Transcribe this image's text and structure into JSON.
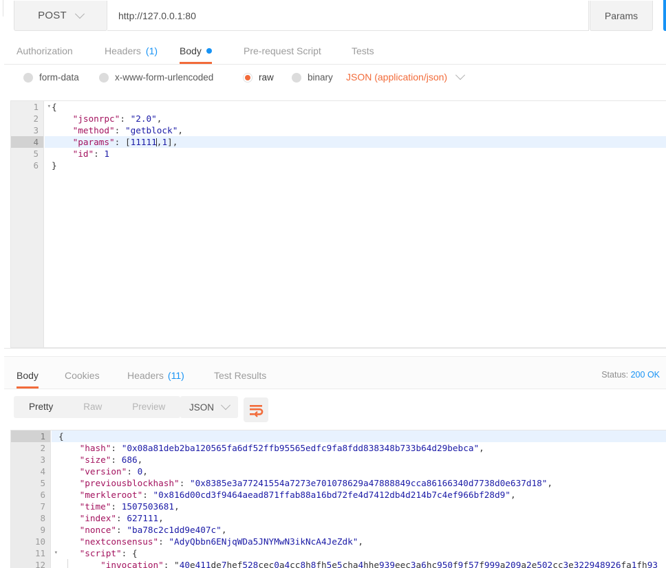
{
  "request_bar": {
    "method": "POST",
    "method_chevron_icon": "chevron-down-icon",
    "url": "http://127.0.0.1:80",
    "params_label": "Params",
    "send_label": ""
  },
  "request_tabs": [
    {
      "label": "Authorization",
      "active": false
    },
    {
      "label": "Headers",
      "count": "(1)",
      "active": false
    },
    {
      "label": "Body",
      "active": true,
      "indicator": "blue-dot"
    },
    {
      "label": "Pre-request Script",
      "active": false
    },
    {
      "label": "Tests",
      "active": false
    }
  ],
  "body_types": [
    {
      "label": "form-data",
      "selected": false
    },
    {
      "label": "x-www-form-urlencoded",
      "selected": false
    },
    {
      "label": "raw",
      "selected": true
    },
    {
      "label": "binary",
      "selected": false
    }
  ],
  "content_type": {
    "label": "JSON (application/json)",
    "chevron_icon": "chevron-down-icon"
  },
  "request_body": {
    "lines": [
      {
        "num": "1",
        "fold": true,
        "highlight": false,
        "text": "{"
      },
      {
        "num": "2",
        "fold": false,
        "highlight": false,
        "text": "    \"jsonrpc\": \"2.0\","
      },
      {
        "num": "3",
        "fold": false,
        "highlight": false,
        "text": "    \"method\": \"getblock\","
      },
      {
        "num": "4",
        "fold": false,
        "highlight": true,
        "text": "    \"params\": [11111,1],"
      },
      {
        "num": "5",
        "fold": false,
        "highlight": false,
        "text": "    \"id\": 1"
      },
      {
        "num": "6",
        "fold": false,
        "highlight": false,
        "text": "}"
      }
    ]
  },
  "response_tabs": [
    {
      "label": "Body",
      "active": true
    },
    {
      "label": "Cookies",
      "active": false
    },
    {
      "label": "Headers",
      "count": "(11)",
      "active": false
    },
    {
      "label": "Test Results",
      "active": false
    }
  ],
  "response_status": {
    "label": "Status:",
    "value": "200 OK",
    "color": "#1793f5"
  },
  "response_toolbar": {
    "view_modes": [
      {
        "label": "Pretty",
        "active": true
      },
      {
        "label": "Raw",
        "active": false
      },
      {
        "label": "Preview",
        "active": false
      }
    ],
    "format": "JSON",
    "format_chevron_icon": "chevron-down-icon",
    "wrap_button_icon": "word-wrap-icon"
  },
  "response_body": {
    "lines": [
      {
        "num": "1",
        "fold": true,
        "highlight": true,
        "text": "{"
      },
      {
        "num": "2",
        "fold": false,
        "highlight": false,
        "text": "    \"hash\": \"0x08a81deb2ba120565fa6df52ffb95565edfc9fa8fdd838348b733b64d29bebca\","
      },
      {
        "num": "3",
        "fold": false,
        "highlight": false,
        "text": "    \"size\": 686,"
      },
      {
        "num": "4",
        "fold": false,
        "highlight": false,
        "text": "    \"version\": 0,"
      },
      {
        "num": "5",
        "fold": false,
        "highlight": false,
        "text": "    \"previousblockhash\": \"0x8385e3a77241554a7273e701078629a47888849cca86166340d7738d0e637d18\","
      },
      {
        "num": "6",
        "fold": false,
        "highlight": false,
        "text": "    \"merkleroot\": \"0x816d00cd3f9464aead871ffab88a16bd72fe4d7412db4d214b7c4ef966bf28d9\","
      },
      {
        "num": "7",
        "fold": false,
        "highlight": false,
        "text": "    \"time\": 1507503681,"
      },
      {
        "num": "8",
        "fold": false,
        "highlight": false,
        "text": "    \"index\": 627111,"
      },
      {
        "num": "9",
        "fold": false,
        "highlight": false,
        "text": "    \"nonce\": \"ba78c2c1dd9e407c\","
      },
      {
        "num": "10",
        "fold": false,
        "highlight": false,
        "text": "    \"nextconsensus\": \"AdyQbbn6ENjqWDa5JNYMwN3ikNcA4JeZdk\","
      },
      {
        "num": "11",
        "fold": true,
        "highlight": false,
        "text": "    \"script\": {"
      },
      {
        "num": "12",
        "fold": false,
        "highlight": false,
        "text": "        \"invocation\": \"40e411de7hef528cec0a4cc8h8fh5e5cha4hhe939eec3a6hc950f9f57f999a209a2e502cc3e322948926fa1fh93"
      }
    ]
  }
}
